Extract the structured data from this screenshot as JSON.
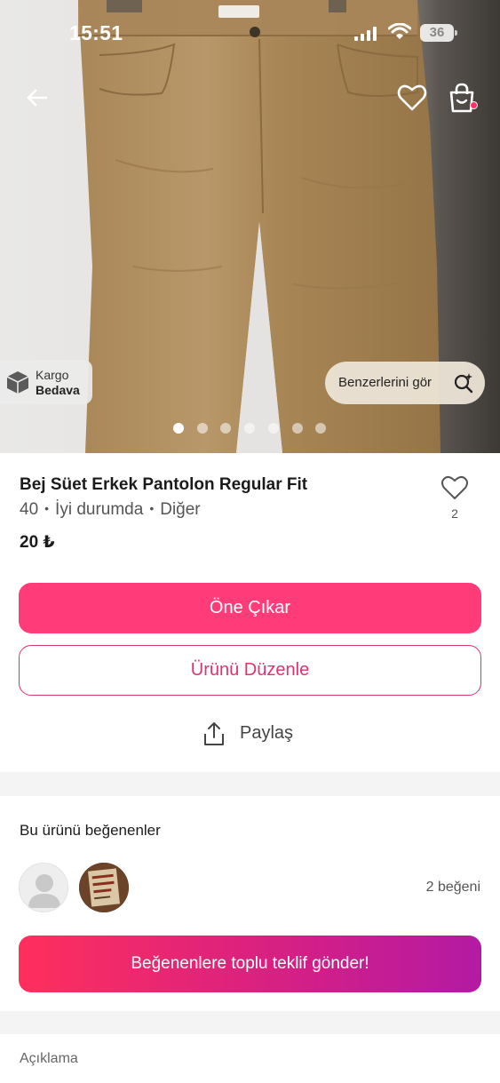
{
  "status_bar": {
    "time": "15:51",
    "battery": "36"
  },
  "hero": {
    "icons": [
      "back-arrow-icon",
      "heart-outline-icon",
      "shopping-bag-icon"
    ],
    "cargo_badge": {
      "line1": "Kargo",
      "line2": "Bedava"
    },
    "similar_button": {
      "label": "Benzerlerini gör",
      "icon": "search-sparkle-icon"
    },
    "carousel": {
      "total": 7,
      "active": 0
    }
  },
  "product": {
    "title": "Bej Süet Erkek Pantolon Regular Fit",
    "size": "40",
    "condition": "İyi durumda",
    "brand": "Diğer",
    "separator": "•",
    "price": "20 ₺",
    "like_count": "2"
  },
  "actions": {
    "promote_label": "Öne Çıkar",
    "edit_label": "Ürünü Düzenle",
    "share_label": "Paylaş"
  },
  "likers": {
    "title": "Bu ürünü beğenenler",
    "count_label": "2 beğeni",
    "bulk_offer_label": "Beğenenlere toplu teklif gönder!"
  },
  "description": {
    "label": "Açıklama"
  },
  "colors": {
    "primary": "#ff3b7a",
    "outline": "#e0336c",
    "gradient_start": "#ff2f5c",
    "gradient_end": "#b31aa3"
  }
}
